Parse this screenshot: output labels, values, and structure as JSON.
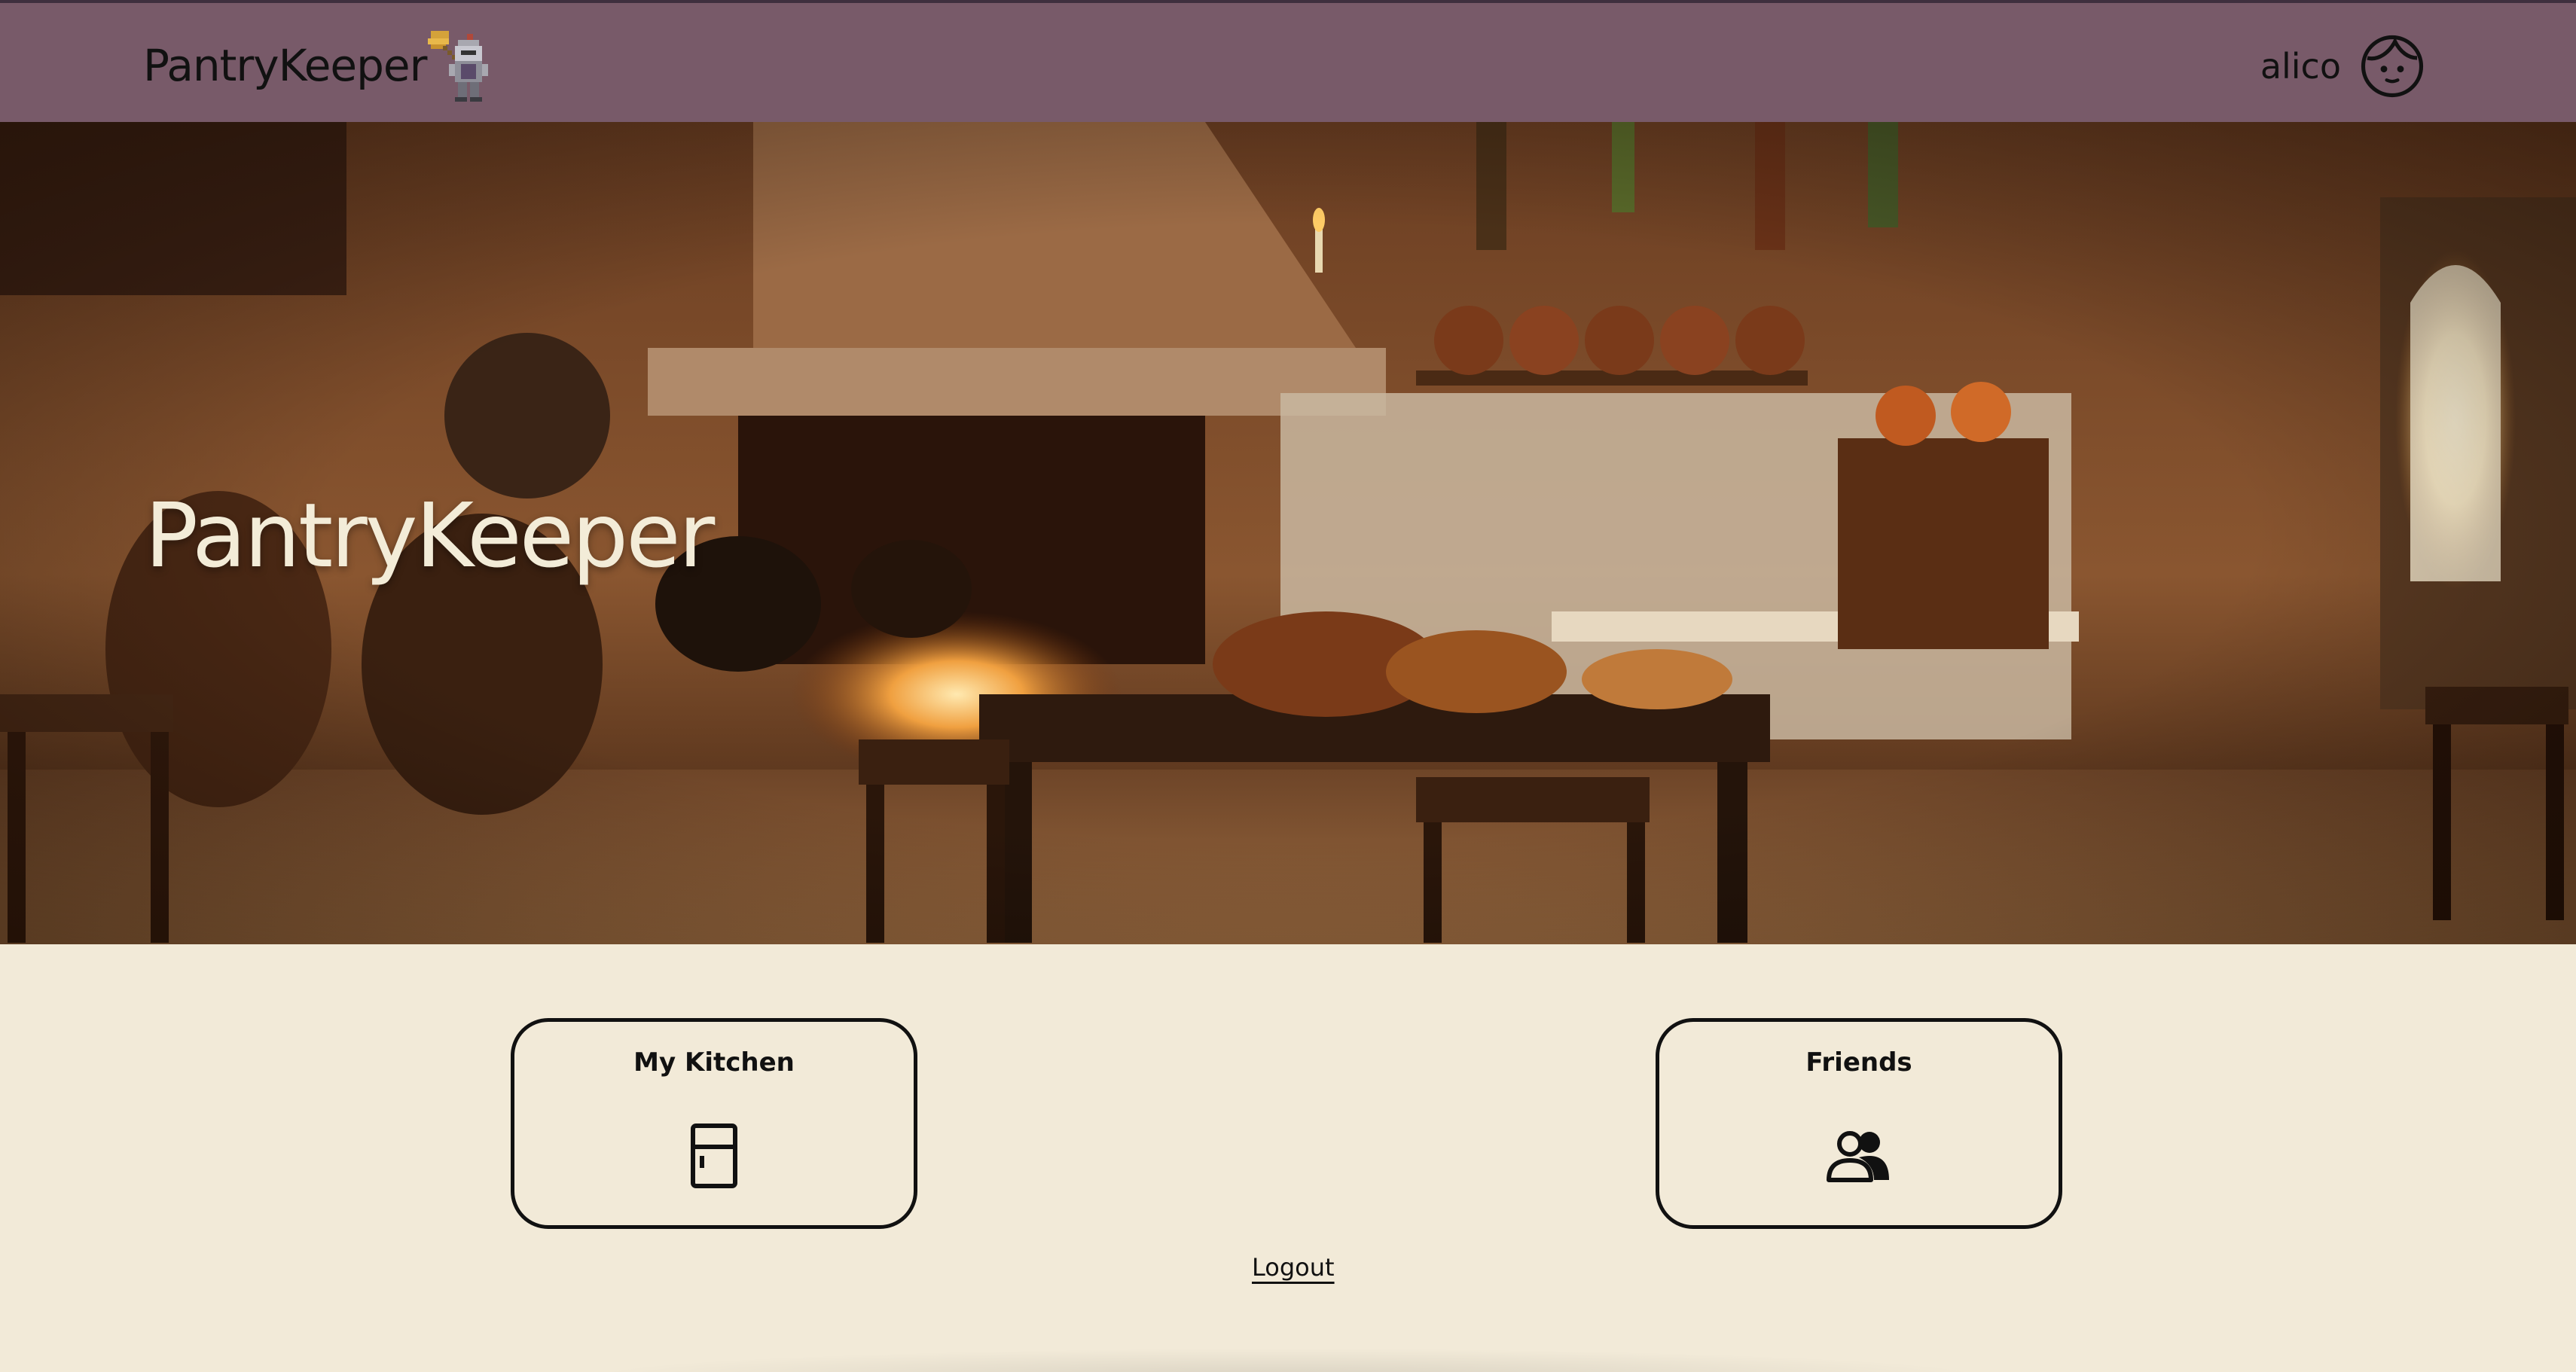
{
  "header": {
    "brand": "PantryKeeper",
    "logo_icon": "knight-with-broom-icon",
    "username": "alico",
    "avatar_icon": "face-avatar-icon"
  },
  "hero": {
    "title": "PantryKeeper",
    "background": "pixel-art medieval kitchen"
  },
  "cards": [
    {
      "label": "My Kitchen",
      "icon": "fridge-icon"
    },
    {
      "label": "Friends",
      "icon": "users-icon"
    }
  ],
  "footer": {
    "logout_label": "Logout"
  },
  "colors": {
    "topbar": "#785a69",
    "background": "#f2ead8",
    "hero_title": "#f3ecd8"
  }
}
